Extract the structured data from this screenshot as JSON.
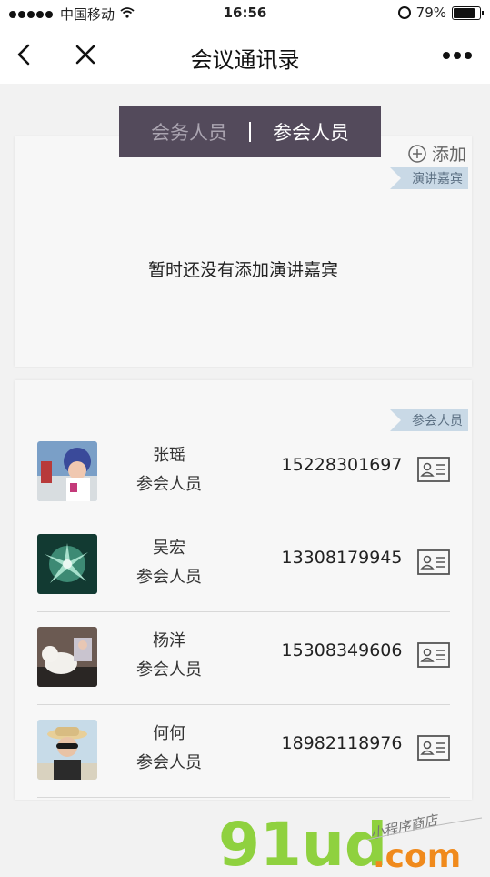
{
  "status_bar": {
    "carrier": "中国移动",
    "time": "16:56",
    "battery": "79%"
  },
  "nav": {
    "title": "会议通讯录"
  },
  "tabs": [
    {
      "label": "会务人员",
      "active": false
    },
    {
      "label": "参会人员",
      "active": true
    }
  ],
  "speakers": {
    "add_label": "添加",
    "ribbon": "演讲嘉宾",
    "empty_text": "暂时还没有添加演讲嘉宾"
  },
  "attendees": {
    "ribbon": "参会人员",
    "rows": [
      {
        "name": "张瑶",
        "role": "参会人员",
        "phone": "15228301697"
      },
      {
        "name": "吴宏",
        "role": "参会人员",
        "phone": "13308179945"
      },
      {
        "name": "杨洋",
        "role": "参会人员",
        "phone": "15308349606"
      },
      {
        "name": "何何",
        "role": "参会人员",
        "phone": "18982118976"
      }
    ]
  },
  "watermark": {
    "brand": "91ud",
    "suffix": ".com",
    "tagline": "小程序商店"
  },
  "colors": {
    "segment_bg": "#534a5b",
    "ribbon_bg": "#c9d9e6",
    "watermark_green": "#8fd13f",
    "watermark_orange": "#f08a1c"
  }
}
